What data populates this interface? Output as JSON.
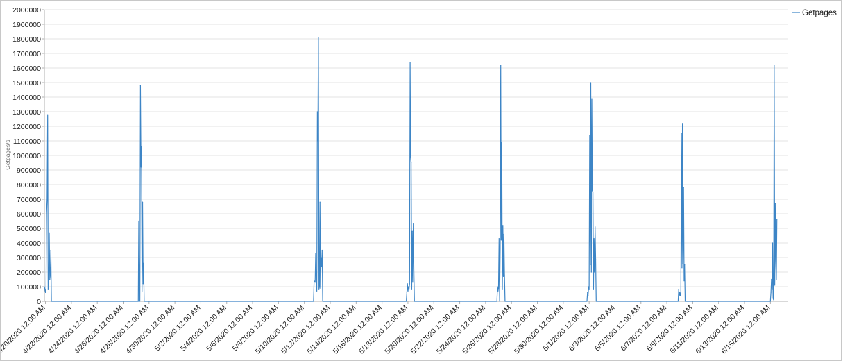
{
  "chart_data": {
    "type": "line",
    "title": "",
    "xlabel": "",
    "ylabel": "Getpages/s",
    "ylim": [
      0,
      2000000
    ],
    "grid": true,
    "legend": "top-right",
    "y_ticks": [
      0,
      100000,
      200000,
      300000,
      400000,
      500000,
      600000,
      700000,
      800000,
      900000,
      1000000,
      1100000,
      1200000,
      1300000,
      1400000,
      1500000,
      1600000,
      1700000,
      1800000,
      1900000,
      2000000
    ],
    "x_tick_labels": [
      "4/20/2020 12:00 AM",
      "4/22/2020 12:00 AM",
      "4/24/2020 12:00 AM",
      "4/26/2020 12:00 AM",
      "4/28/2020 12:00 AM",
      "4/30/2020 12:00 AM",
      "5/2/2020 12:00 AM",
      "5/4/2020 12:00 AM",
      "5/6/2020 12:00 AM",
      "5/8/2020 12:00 AM",
      "5/10/2020 12:00 AM",
      "5/12/2020 12:00 AM",
      "5/14/2020 12:00 AM",
      "5/16/2020 12:00 AM",
      "5/18/2020 12:00 AM",
      "5/20/2020 12:00 AM",
      "5/22/2020 12:00 AM",
      "5/24/2020 12:00 AM",
      "5/26/2020 12:00 AM",
      "5/28/2020 12:00 AM",
      "5/30/2020 12:00 AM",
      "6/1/2020 12:00 AM",
      "6/3/2020 12:00 AM",
      "6/5/2020 12:00 AM",
      "6/7/2020 12:00 AM",
      "6/9/2020 12:00 AM",
      "6/11/2020 12:00 AM",
      "6/13/2020 12:00 AM",
      "6/15/2020 12:00 AM"
    ],
    "x_start": "2020-04-19T22:00",
    "x_end": "2020-06-16T09:00",
    "colors": {
      "series": "#3d85c6",
      "grid": "#e3e3e3",
      "axis": "#b0b0b0"
    },
    "series": [
      {
        "name": "Getpages",
        "points": [
          [
            "2020-04-19T22:00",
            100000
          ],
          [
            "2020-04-20T00:00",
            60000
          ],
          [
            "2020-04-20T01:00",
            80000
          ],
          [
            "2020-04-20T02:00",
            600000
          ],
          [
            "2020-04-20T03:00",
            700000
          ],
          [
            "2020-04-20T04:00",
            1280000
          ],
          [
            "2020-04-20T05:00",
            80000
          ],
          [
            "2020-04-20T06:00",
            80000
          ],
          [
            "2020-04-20T07:00",
            470000
          ],
          [
            "2020-04-20T08:00",
            150000
          ],
          [
            "2020-04-20T09:00",
            180000
          ],
          [
            "2020-04-20T10:00",
            350000
          ],
          [
            "2020-04-20T11:00",
            0
          ],
          [
            "2020-04-27T04:00",
            0
          ],
          [
            "2020-04-27T05:00",
            550000
          ],
          [
            "2020-04-27T06:00",
            90000
          ],
          [
            "2020-04-27T07:00",
            0
          ],
          [
            "2020-04-27T08:00",
            1480000
          ],
          [
            "2020-04-27T09:00",
            920000
          ],
          [
            "2020-04-27T10:00",
            1060000
          ],
          [
            "2020-04-27T11:00",
            70000
          ],
          [
            "2020-04-27T12:00",
            680000
          ],
          [
            "2020-04-27T13:00",
            120000
          ],
          [
            "2020-04-27T14:00",
            260000
          ],
          [
            "2020-04-27T15:00",
            0
          ],
          [
            "2020-05-10T17:00",
            0
          ],
          [
            "2020-05-10T18:00",
            140000
          ],
          [
            "2020-05-10T20:00",
            130000
          ],
          [
            "2020-05-10T21:00",
            330000
          ],
          [
            "2020-05-10T22:00",
            120000
          ],
          [
            "2020-05-10T23:00",
            70000
          ],
          [
            "2020-05-11T00:00",
            1300000
          ],
          [
            "2020-05-11T01:00",
            1100000
          ],
          [
            "2020-05-11T02:00",
            1810000
          ],
          [
            "2020-05-11T03:00",
            80000
          ],
          [
            "2020-05-11T04:00",
            100000
          ],
          [
            "2020-05-11T05:00",
            680000
          ],
          [
            "2020-05-11T06:00",
            90000
          ],
          [
            "2020-05-11T07:00",
            300000
          ],
          [
            "2020-05-11T08:00",
            240000
          ],
          [
            "2020-05-11T09:00",
            350000
          ],
          [
            "2020-05-11T10:00",
            0
          ],
          [
            "2020-05-17T21:00",
            0
          ],
          [
            "2020-05-17T22:00",
            60000
          ],
          [
            "2020-05-17T23:00",
            120000
          ],
          [
            "2020-05-18T00:00",
            70000
          ],
          [
            "2020-05-18T01:00",
            100000
          ],
          [
            "2020-05-18T02:00",
            80000
          ],
          [
            "2020-05-18T03:00",
            120000
          ],
          [
            "2020-05-18T04:00",
            1640000
          ],
          [
            "2020-05-18T05:00",
            1000000
          ],
          [
            "2020-05-18T06:00",
            950000
          ],
          [
            "2020-05-18T07:00",
            80000
          ],
          [
            "2020-05-18T08:00",
            480000
          ],
          [
            "2020-05-18T09:00",
            130000
          ],
          [
            "2020-05-18T10:00",
            530000
          ],
          [
            "2020-05-18T11:00",
            220000
          ],
          [
            "2020-05-18T12:00",
            0
          ],
          [
            "2020-05-24T21:00",
            0
          ],
          [
            "2020-05-24T22:00",
            100000
          ],
          [
            "2020-05-24T23:00",
            70000
          ],
          [
            "2020-05-25T00:00",
            90000
          ],
          [
            "2020-05-25T01:00",
            430000
          ],
          [
            "2020-05-25T02:00",
            0
          ],
          [
            "2020-05-25T03:00",
            360000
          ],
          [
            "2020-05-25T04:00",
            1620000
          ],
          [
            "2020-05-25T05:00",
            420000
          ],
          [
            "2020-05-25T06:00",
            1090000
          ],
          [
            "2020-05-25T07:00",
            80000
          ],
          [
            "2020-05-25T08:00",
            520000
          ],
          [
            "2020-05-25T09:00",
            170000
          ],
          [
            "2020-05-25T10:00",
            460000
          ],
          [
            "2020-05-25T11:00",
            180000
          ],
          [
            "2020-05-25T12:00",
            0
          ],
          [
            "2020-05-31T20:00",
            0
          ],
          [
            "2020-05-31T21:00",
            60000
          ],
          [
            "2020-05-31T22:00",
            40000
          ],
          [
            "2020-05-31T23:00",
            100000
          ],
          [
            "2020-06-01T00:00",
            80000
          ],
          [
            "2020-06-01T01:00",
            1140000
          ],
          [
            "2020-06-01T02:00",
            250000
          ],
          [
            "2020-06-01T03:00",
            1500000
          ],
          [
            "2020-06-01T04:00",
            200000
          ],
          [
            "2020-06-01T05:00",
            1390000
          ],
          [
            "2020-06-01T06:00",
            760000
          ],
          [
            "2020-06-01T07:00",
            750000
          ],
          [
            "2020-06-01T08:00",
            80000
          ],
          [
            "2020-06-01T09:00",
            430000
          ],
          [
            "2020-06-01T10:00",
            200000
          ],
          [
            "2020-06-01T11:00",
            510000
          ],
          [
            "2020-06-01T12:00",
            290000
          ],
          [
            "2020-06-01T13:00",
            0
          ],
          [
            "2020-06-07T21:00",
            0
          ],
          [
            "2020-06-07T22:00",
            80000
          ],
          [
            "2020-06-07T23:00",
            40000
          ],
          [
            "2020-06-08T00:00",
            60000
          ],
          [
            "2020-06-08T01:00",
            40000
          ],
          [
            "2020-06-08T02:00",
            60000
          ],
          [
            "2020-06-08T03:00",
            1150000
          ],
          [
            "2020-06-08T04:00",
            230000
          ],
          [
            "2020-06-08T05:00",
            1220000
          ],
          [
            "2020-06-08T06:00",
            260000
          ],
          [
            "2020-06-08T07:00",
            780000
          ],
          [
            "2020-06-08T08:00",
            140000
          ],
          [
            "2020-06-08T09:00",
            250000
          ],
          [
            "2020-06-08T10:00",
            0
          ],
          [
            "2020-06-15T00:00",
            0
          ],
          [
            "2020-06-15T01:00",
            60000
          ],
          [
            "2020-06-15T02:00",
            150000
          ],
          [
            "2020-06-15T03:00",
            80000
          ],
          [
            "2020-06-15T04:00",
            400000
          ],
          [
            "2020-06-15T05:00",
            20000
          ],
          [
            "2020-06-15T06:00",
            10000
          ],
          [
            "2020-06-15T07:00",
            1620000
          ],
          [
            "2020-06-15T08:00",
            110000
          ],
          [
            "2020-06-15T09:00",
            670000
          ],
          [
            "2020-06-15T10:00",
            280000
          ],
          [
            "2020-06-15T11:00",
            150000
          ],
          [
            "2020-06-15T12:00",
            560000
          ]
        ]
      }
    ]
  }
}
